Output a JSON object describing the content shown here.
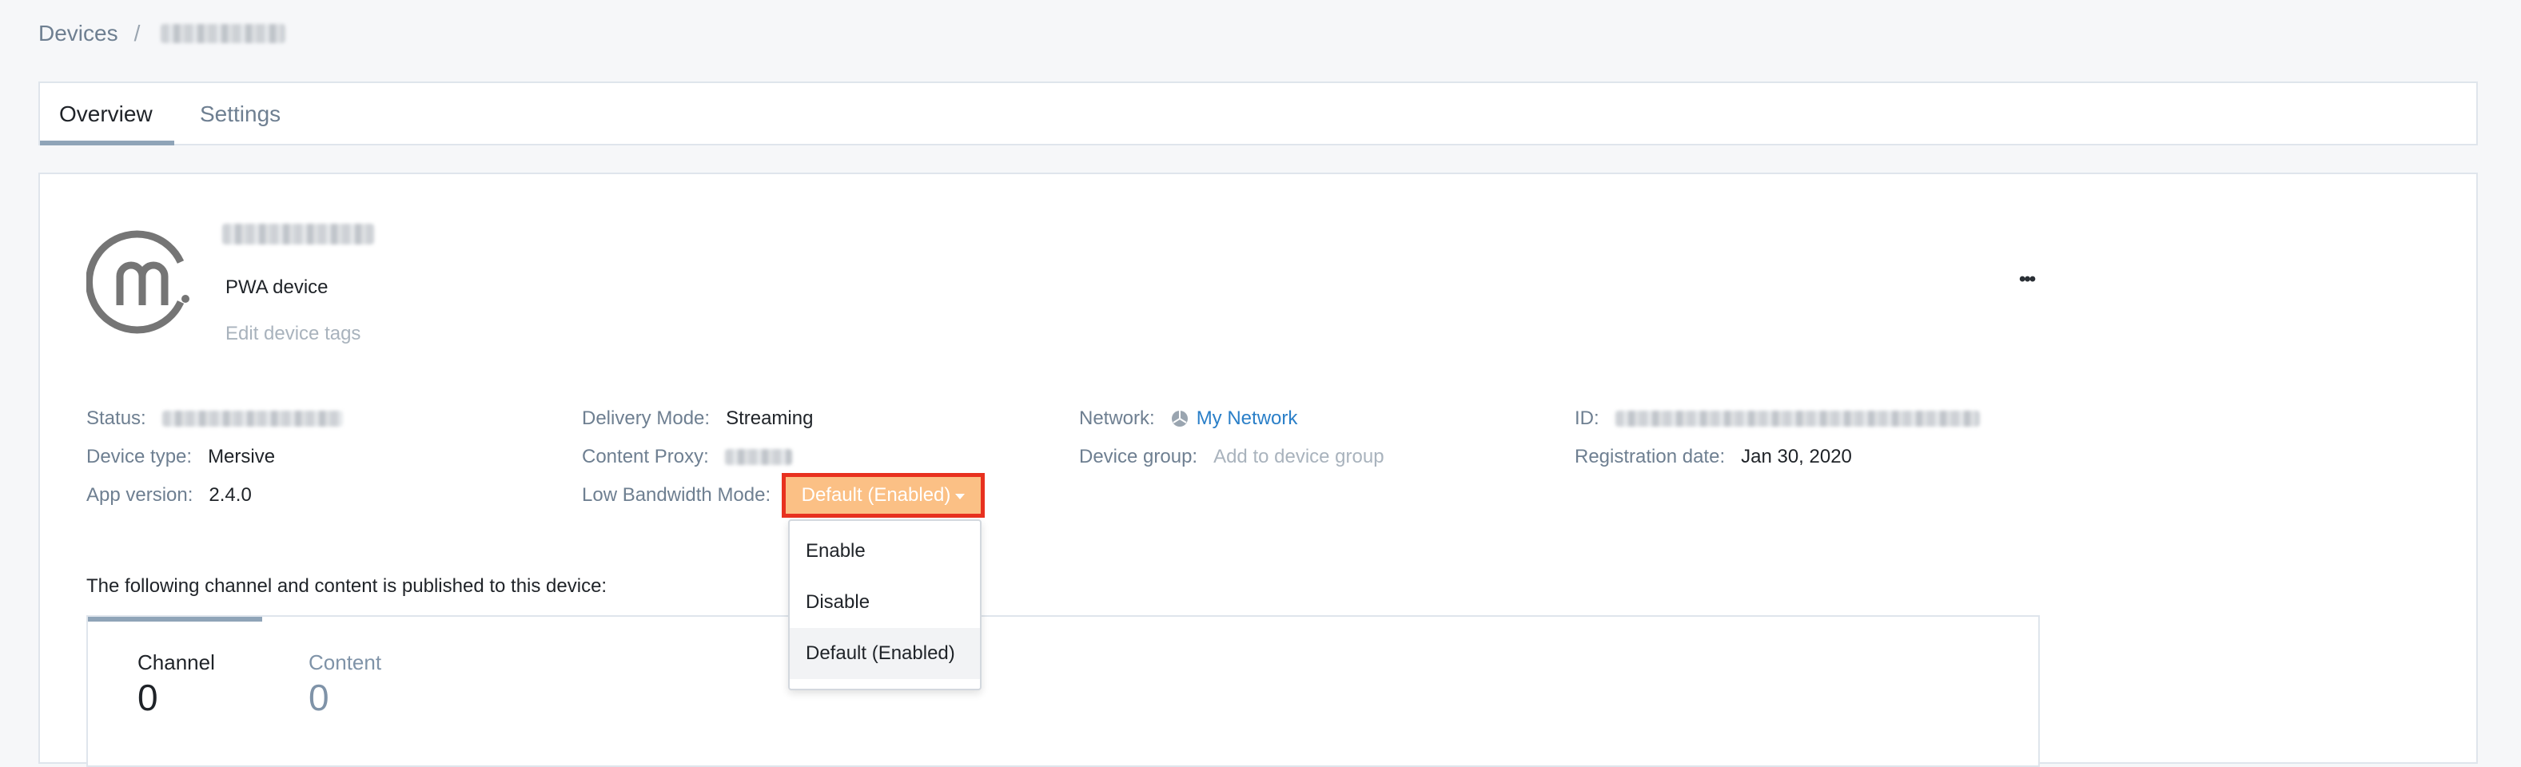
{
  "breadcrumb": {
    "root": "Devices",
    "separator": "/",
    "current_redacted": true
  },
  "tabs": [
    {
      "label": "Overview",
      "active": true
    },
    {
      "label": "Settings",
      "active": false
    }
  ],
  "device": {
    "logo_icon": "mersive-m-logo",
    "type_label": "PWA device",
    "edit_tags": "Edit device tags",
    "more_icon": "more-dots-icon"
  },
  "fields": {
    "status_label": "Status:",
    "device_type_label": "Device type:",
    "device_type": "Mersive",
    "app_version_label": "App version:",
    "app_version": "2.4.0",
    "delivery_mode_label": "Delivery Mode:",
    "delivery_mode": "Streaming",
    "content_proxy_label": "Content Proxy:",
    "low_bandwidth_label": "Low Bandwidth Mode:",
    "network_label": "Network:",
    "network": "My Network",
    "network_icon": "network-globe-icon",
    "device_group_label": "Device group:",
    "device_group_placeholder": "Add to device group",
    "id_label": "ID:",
    "registration_label": "Registration date:",
    "registration_date": "Jan 30, 2020"
  },
  "low_bandwidth_dropdown": {
    "selected": "Default (Enabled)",
    "options": [
      "Enable",
      "Disable",
      "Default (Enabled)"
    ],
    "highlight_color": "#e8311f",
    "button_color": "#fbc085"
  },
  "published_text": "The following channel and content is published to this device:",
  "counters": [
    {
      "label": "Channel",
      "value": "0"
    },
    {
      "label": "Content",
      "value": "0"
    }
  ]
}
